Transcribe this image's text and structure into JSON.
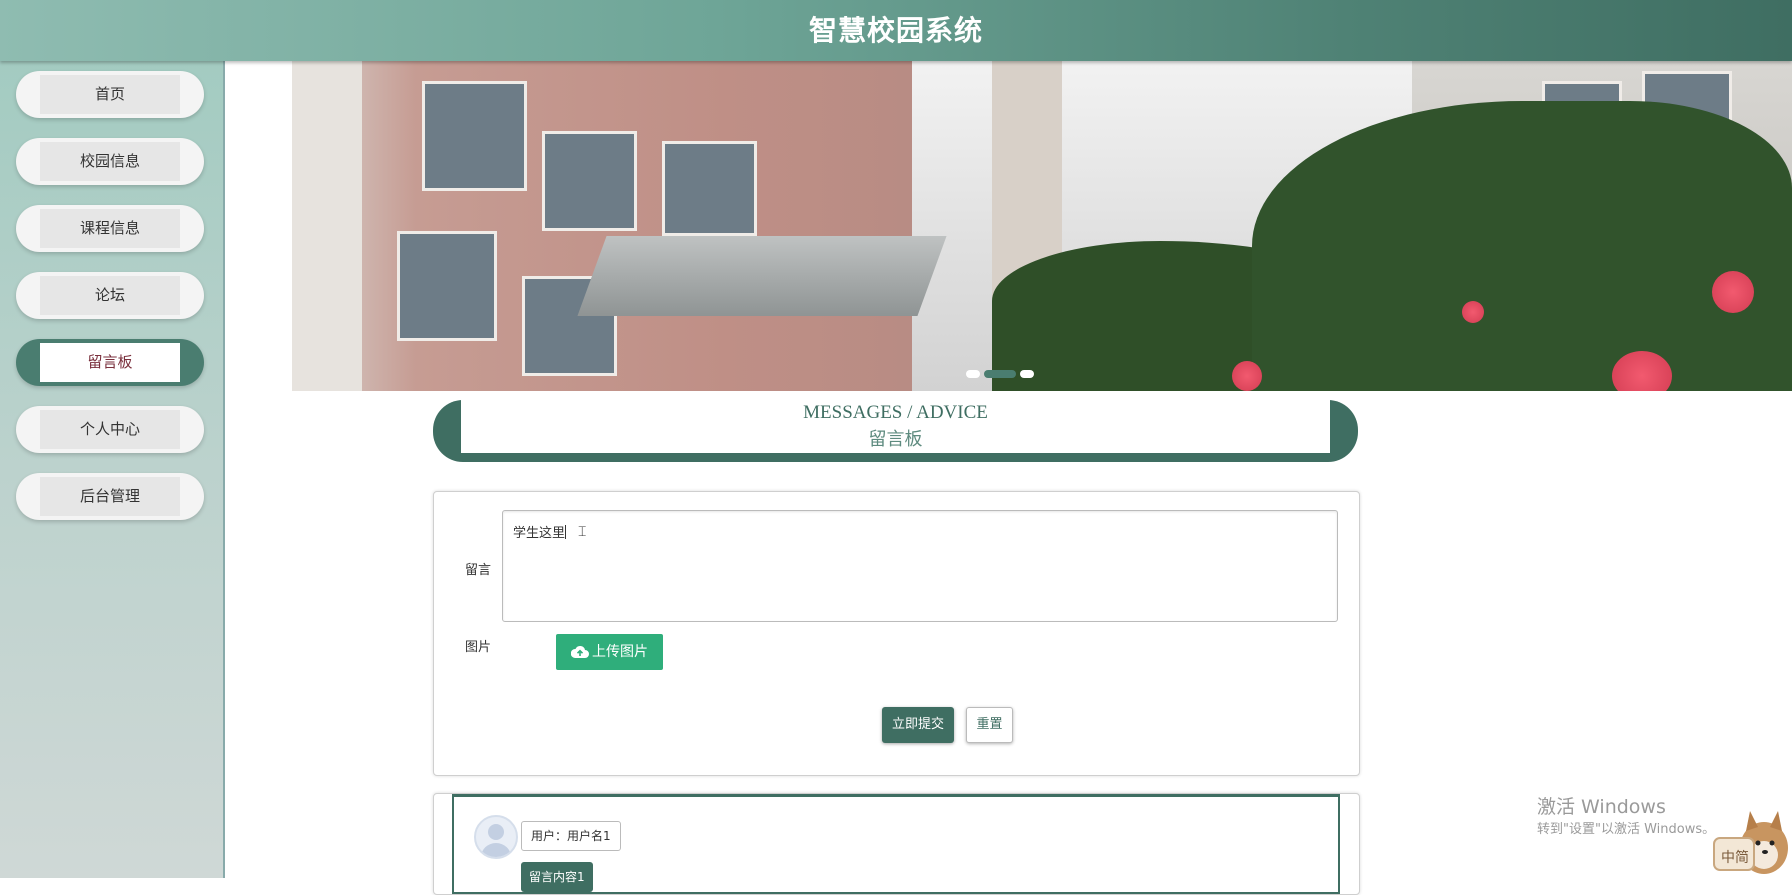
{
  "header": {
    "title": "智慧校园系统"
  },
  "sidebar": {
    "items": [
      {
        "label": "首页"
      },
      {
        "label": "校园信息"
      },
      {
        "label": "课程信息"
      },
      {
        "label": "论坛"
      },
      {
        "label": "留言板",
        "active": true
      },
      {
        "label": "个人中心"
      },
      {
        "label": "后台管理"
      }
    ]
  },
  "banner": {
    "slides": 3,
    "active_slide": 2
  },
  "section": {
    "title_en": "MESSAGES / ADVICE",
    "title_zh": "留言板"
  },
  "form": {
    "message_label": "留言",
    "message_value": "学生这里",
    "image_label": "图片",
    "upload_label": "上传图片",
    "submit_label": "立即提交",
    "reset_label": "重置"
  },
  "messages": [
    {
      "user": "用户：用户名1",
      "content": "留言内容1"
    }
  ],
  "watermark": {
    "line1": "激活 Windows",
    "line2": "转到\"设置\"以激活 Windows。"
  },
  "ime": {
    "label": "中简"
  },
  "colors": {
    "primary": "#3f6e62",
    "upload": "#2fae7b",
    "active_text": "#7a2f3c"
  }
}
